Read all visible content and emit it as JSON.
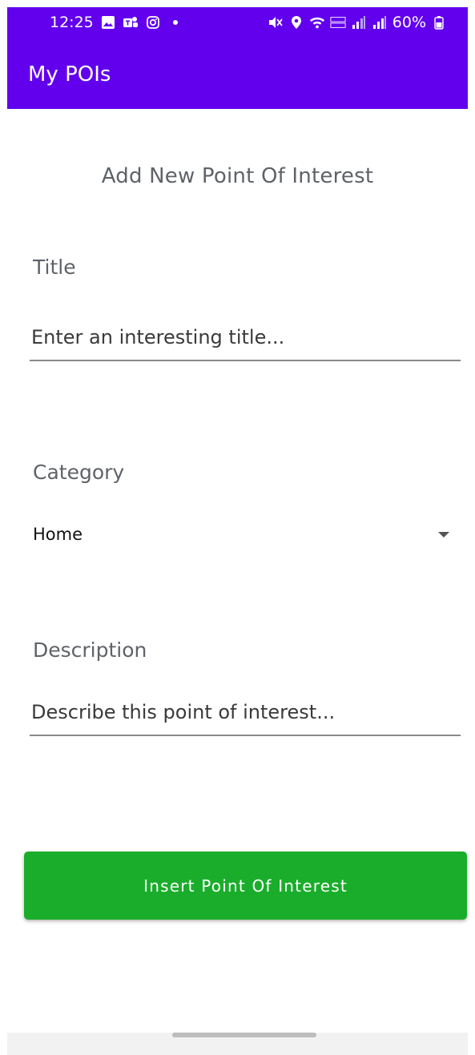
{
  "status_bar": {
    "time": "12:25",
    "battery": "60%",
    "left_icons": [
      "gallery-icon",
      "teams-icon",
      "instagram-icon",
      "notification-dot-icon"
    ],
    "right_icons": [
      "mute-icon",
      "location-icon",
      "wifi-icon",
      "volte-icon",
      "signal-icon",
      "signal-icon",
      "battery-icon"
    ]
  },
  "app_bar": {
    "title": "My POIs",
    "color": "#6200ee"
  },
  "form": {
    "heading": "Add New Point Of Interest",
    "title_label": "Title",
    "title_placeholder": "Enter an interesting title...",
    "category_label": "Category",
    "category_selected": "Home",
    "description_label": "Description",
    "description_placeholder": "Describe this point of interest..."
  },
  "actions": {
    "insert_label": "Insert Point Of Interest",
    "insert_color": "#1aad2b"
  }
}
